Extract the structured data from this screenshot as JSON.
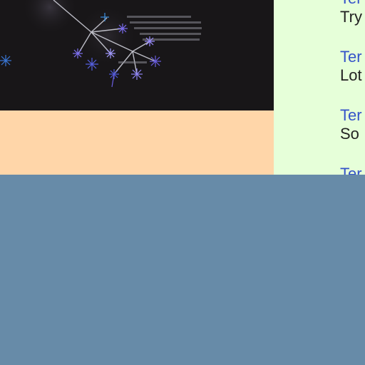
{
  "image": {
    "icon": "dandelion-graph-image",
    "background_color": "#181618"
  },
  "comments": [
    {
      "author": "Ter",
      "snippet": "Try"
    },
    {
      "author": "Ter",
      "snippet": "Lot"
    },
    {
      "author": "Ter",
      "snippet": "So"
    },
    {
      "author": "Ter",
      "snippet": ""
    }
  ],
  "colors": {
    "sidebar_bg": "#e6ffd9",
    "peach_strip": "#ffd6a9",
    "bottom_bg": "#678ba8",
    "link": "#3553c9",
    "text": "#222222"
  }
}
